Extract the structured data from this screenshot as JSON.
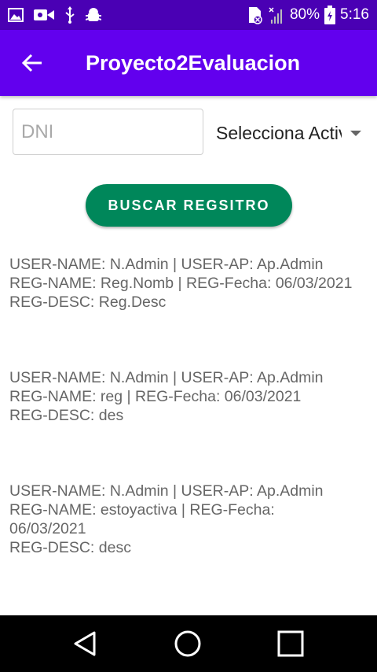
{
  "status_bar": {
    "icons": [
      "image-icon",
      "video-camera-icon",
      "usb-icon",
      "android-debug-icon",
      "sim-icon",
      "signal-icon",
      "battery-icon"
    ],
    "battery": "80%",
    "time": "5:16"
  },
  "app_bar": {
    "title": "Proyecto2Evaluacion"
  },
  "form": {
    "dni_placeholder": "DNI",
    "dni_value": "",
    "spinner_selected": "Selecciona Actividad",
    "search_label": "BUSCAR REGSITRO"
  },
  "records": [
    {
      "user_line": "USER-NAME: N.Admin | USER-AP: Ap.Admin",
      "reg_line": "REG-NAME: Reg.Nomb | REG-Fecha: 06/03/2021",
      "desc_line": "REG-DESC: Reg.Desc"
    },
    {
      "user_line": "USER-NAME: N.Admin | USER-AP: Ap.Admin",
      "reg_line": "REG-NAME: reg | REG-Fecha: 06/03/2021",
      "desc_line": "REG-DESC: des"
    },
    {
      "user_line": "USER-NAME: N.Admin | USER-AP: Ap.Admin",
      "reg_line": "REG-NAME: estoyactiva | REG-Fecha: 06/03/2021",
      "desc_line": "REG-DESC: desc"
    }
  ],
  "colors": {
    "status_bar": "#4a00b4",
    "app_bar": "#6200ee",
    "button": "#00875a",
    "record_text": "#666666",
    "nav_bar": "#000000"
  }
}
